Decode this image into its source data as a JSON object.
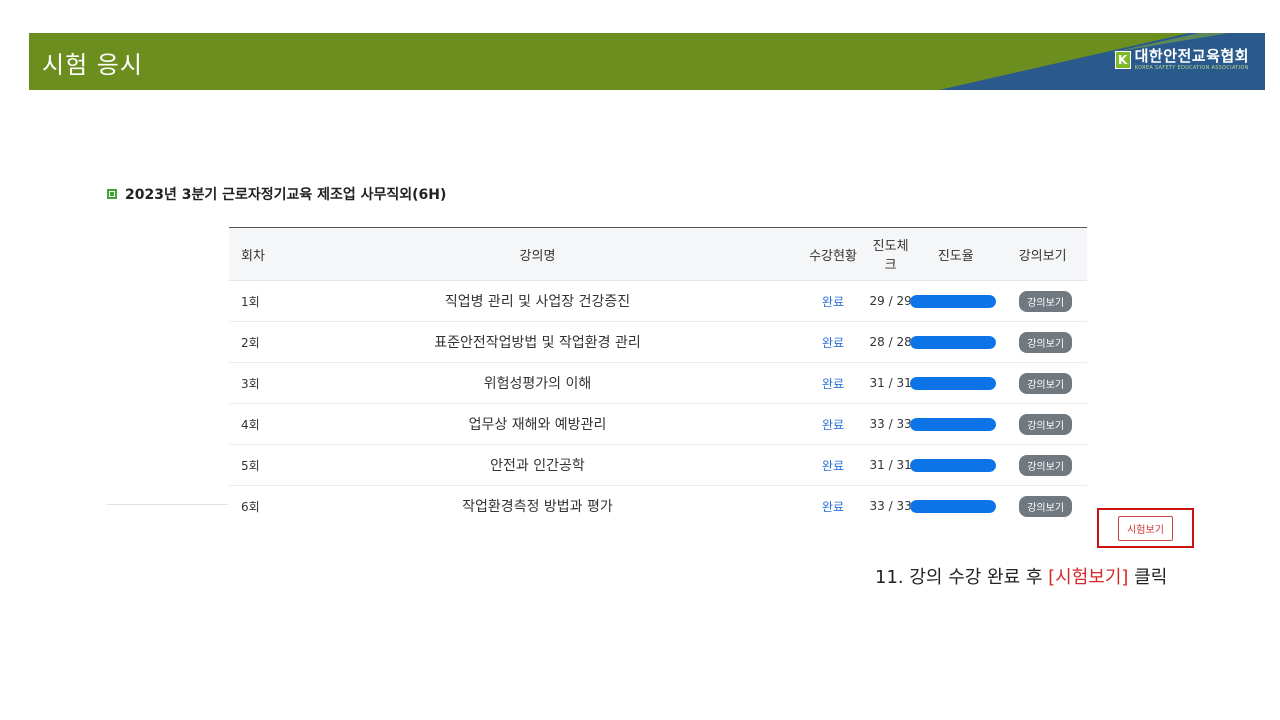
{
  "header": {
    "title": "시험 응시",
    "logo_main": "대한안전교육협회",
    "logo_sub": "KOREA SAFETY EDUCATION ASSOCIATION",
    "logo_mark": "K"
  },
  "course": {
    "title": "2023년 3분기 근로자정기교육 제조업 사무직외(6H)"
  },
  "table": {
    "headers": {
      "no": "회차",
      "name": "강의명",
      "status": "수강현황",
      "check": "진도체크",
      "rate": "진도율",
      "view": "강의보기"
    },
    "rows": [
      {
        "no": "1회",
        "name": "직업병 관리 및 사업장 건강증진",
        "status": "완료",
        "check": "29 / 29",
        "progress": 1.0,
        "view": "강의보기"
      },
      {
        "no": "2회",
        "name": "표준안전작업방법 및 작업환경 관리",
        "status": "완료",
        "check": "28 / 28",
        "progress": 1.0,
        "view": "강의보기"
      },
      {
        "no": "3회",
        "name": "위험성평가의 이해",
        "status": "완료",
        "check": "31 / 31",
        "progress": 1.0,
        "view": "강의보기"
      },
      {
        "no": "4회",
        "name": "업무상 재해와 예방관리",
        "status": "완료",
        "check": "33 / 33",
        "progress": 1.0,
        "view": "강의보기"
      },
      {
        "no": "5회",
        "name": "안전과 인간공학",
        "status": "완료",
        "check": "31 / 31",
        "progress": 1.0,
        "view": "강의보기"
      },
      {
        "no": "6회",
        "name": "작업환경측정 방법과 평가",
        "status": "완료",
        "check": "33 / 33",
        "progress": 1.0,
        "view": "강의보기"
      }
    ]
  },
  "exam_button": "시험보기",
  "caption": {
    "prefix": "11. 강의 수강 완료 후 ",
    "highlight": "[시험보기]",
    "suffix": " 클릭"
  },
  "colors": {
    "banner_green": "#6b8e1f",
    "banner_blue": "#2a5a8c",
    "progress_blue": "#0d74e7",
    "status_blue": "#2a6fd6",
    "highlight_red": "#cc1111"
  }
}
